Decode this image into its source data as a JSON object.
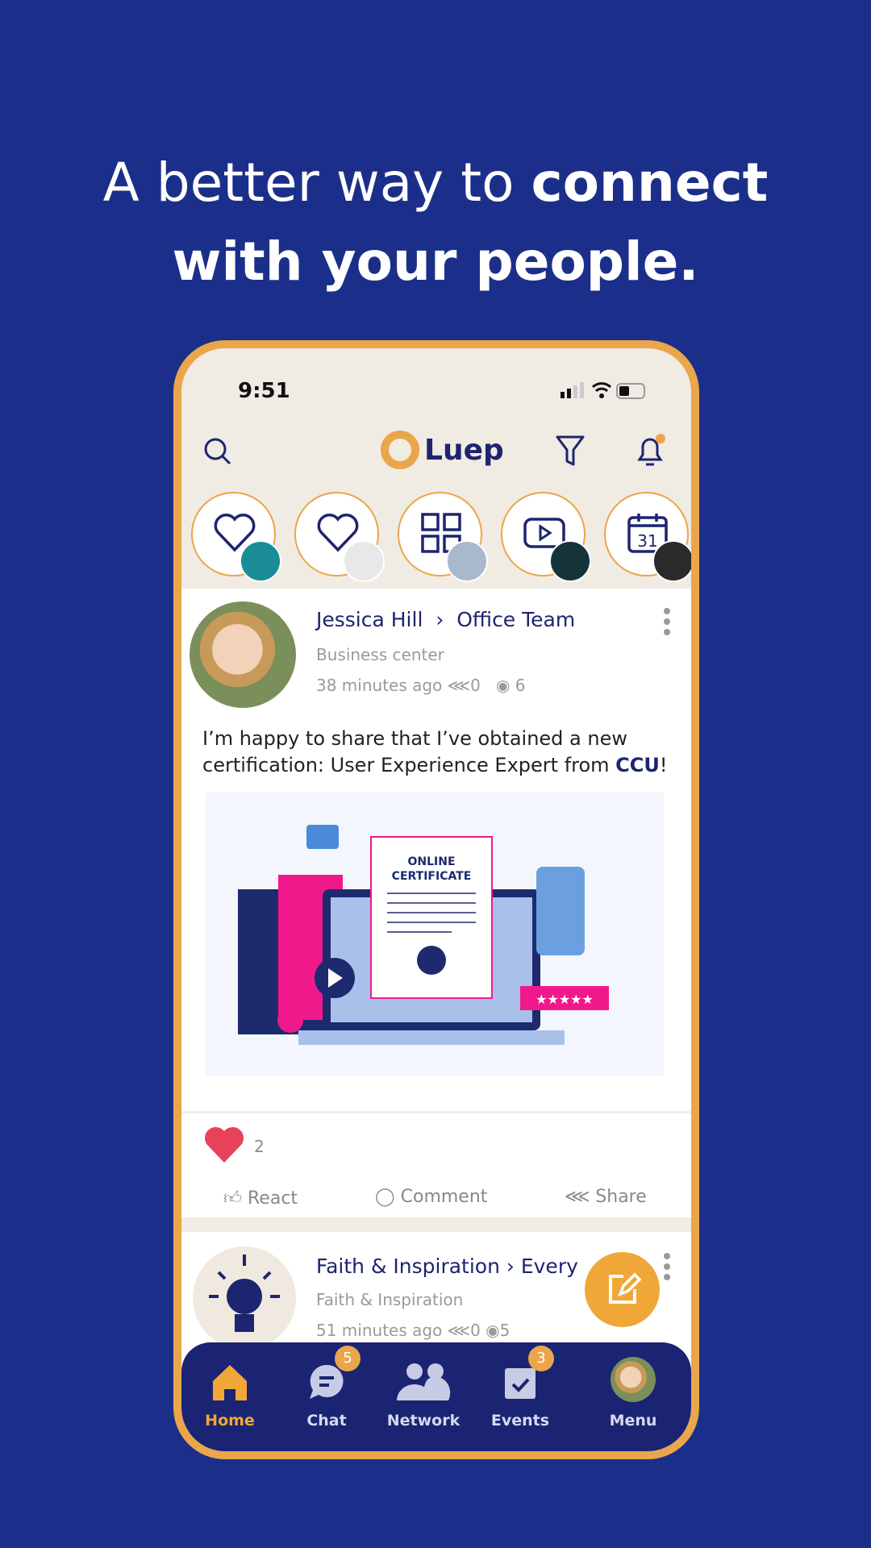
{
  "headline": {
    "line1_regular": "A better way to ",
    "line1_bold": "connect",
    "line2_bold": "with your people."
  },
  "status": {
    "time": "9:51"
  },
  "header": {
    "logo": "Luep",
    "icons": [
      "search-icon",
      "filter-icon",
      "bell-icon"
    ]
  },
  "stories": [
    {
      "icon": "heart-icon"
    },
    {
      "icon": "heart-icon"
    },
    {
      "icon": "grid-icon"
    },
    {
      "icon": "play-icon"
    },
    {
      "icon": "calendar-icon",
      "text": "31"
    }
  ],
  "post1": {
    "author": "Jessica Hill",
    "group": "Office Team",
    "location": "Business center",
    "time": "38 minutes ago",
    "shares": "0",
    "views": "6",
    "text_before": "I’m happy to share that I’ve obtained a new certification: User Experience Expert from ",
    "text_highlight": "CCU",
    "text_after": "!",
    "image_title_line1": "ONLINE",
    "image_title_line2": "CERTIFICATE",
    "reactions": "2",
    "actions": {
      "react": "React",
      "comment": "Comment",
      "share": "Share"
    }
  },
  "post2": {
    "author": "Faith & Inspiration",
    "group": "Every",
    "location": "Faith & Inspiration",
    "time": "51 minutes ago",
    "shares": "0",
    "views": "5"
  },
  "nav": [
    {
      "label": "Home",
      "active": true
    },
    {
      "label": "Chat",
      "badge": "5"
    },
    {
      "label": "Network"
    },
    {
      "label": "Events",
      "badge": "3"
    },
    {
      "label": "Menu"
    }
  ],
  "colors": {
    "background": "#1b2f8a",
    "accent": "#eaa64a",
    "navy": "#1d2470",
    "heart": "#e8415a"
  }
}
